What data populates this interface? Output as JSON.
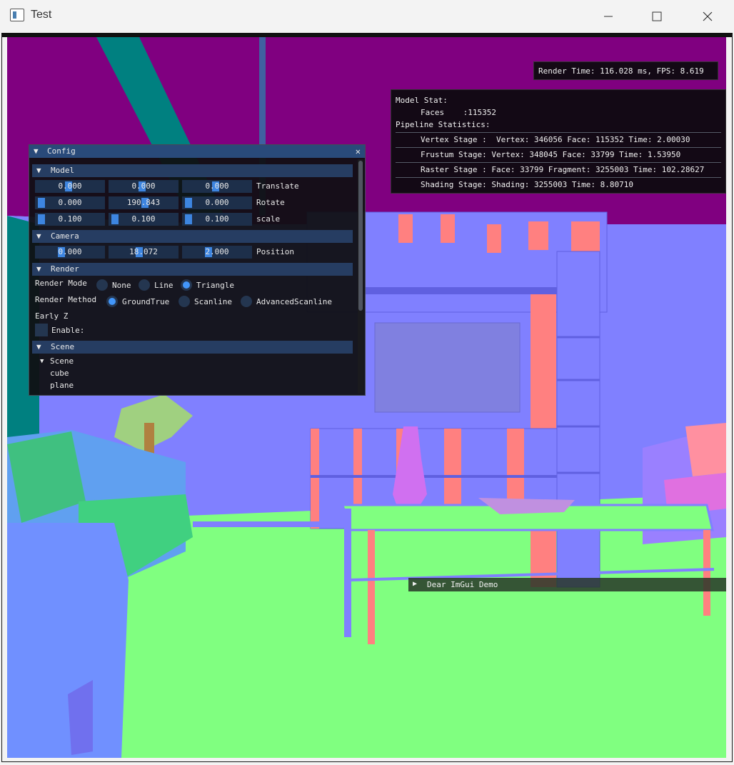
{
  "window": {
    "title": "Test",
    "minimize_icon": "minimize-icon",
    "maximize_icon": "maximize-icon",
    "close_icon": "close-icon"
  },
  "stats_overlay": {
    "render_time": "Render Time: 116.028 ms, FPS: 8.619"
  },
  "model_stat": {
    "heading": "Model Stat:",
    "faces": "Faces    :115352",
    "pipeline_heading": "Pipeline Statistics:",
    "rows": [
      "Vertex Stage :  Vertex: 346056 Face: 115352 Time: 2.00030",
      "Frustum Stage: Vertex: 348045 Face: 33799 Time: 1.53950",
      "Raster Stage : Face: 33799 Fragment: 3255003 Time: 102.28627",
      "Shading Stage: Shading: 3255003 Time: 8.80710"
    ]
  },
  "config": {
    "title": "Config",
    "model": {
      "header": "Model",
      "translate": {
        "values": [
          "0.000",
          "0.000",
          "0.000"
        ],
        "label": "Translate"
      },
      "rotate": {
        "values": [
          "0.000",
          "190.843",
          "0.000"
        ],
        "label": "Rotate"
      },
      "scale": {
        "values": [
          "0.100",
          "0.100",
          "0.100"
        ],
        "label": "scale"
      }
    },
    "camera": {
      "header": "Camera",
      "position": {
        "values": [
          "0.000",
          "18.072",
          "2.000"
        ],
        "label": "Position"
      }
    },
    "render": {
      "header": "Render",
      "mode_label": "Render Mode",
      "mode_options": [
        "None",
        "Line",
        "Triangle"
      ],
      "mode_selected": "Triangle",
      "method_label": "Render Method",
      "method_options": [
        "GroundTrue",
        "Scanline",
        "AdvancedScanline"
      ],
      "method_selected": "GroundTrue",
      "early_z_label": "Early Z",
      "enable_label": "Enable:"
    },
    "scene": {
      "header": "Scene",
      "tree_root": "Scene",
      "items": [
        "cube",
        "plane"
      ]
    }
  },
  "demo_window": {
    "label": "Dear ImGui Demo"
  },
  "colors": {
    "imgui_title": "#294a7a",
    "imgui_header": "#263d62",
    "imgui_frame": "#1d2f4a",
    "imgui_accent": "#4296fa",
    "floor": "#80ff80",
    "wall": "#8080ff",
    "ceiling": "#800080"
  }
}
